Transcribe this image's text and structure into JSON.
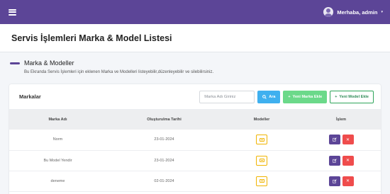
{
  "topbar": {
    "user_label": "Merhaba, admin",
    "caret": "▾",
    "menu_icon": "hamburger-menu-icon",
    "avatar_icon": "user-avatar-icon"
  },
  "page": {
    "title": "Servis İşlemleri Marka & Model Listesi"
  },
  "section": {
    "title": "Marka & Modeller",
    "description": "Bu Ekranda Servis İşlemleri için eklenen Marka ve Modelleri listeyebilir,düzenleyebilir ve silebilirsiniz."
  },
  "card": {
    "title": "Markalar",
    "search_placeholder": "Marka Adı Giriniz",
    "search_button": "Ara",
    "add_brand_button": "Yeni Marka Ekle",
    "add_model_button": "Yeni Model Ekle"
  },
  "table": {
    "headers": [
      "Marka Adı",
      "Oluşturulma Tarihi",
      "Modeller",
      "İşlem"
    ],
    "rows": [
      {
        "name": "Norm",
        "date": "23-01-2024"
      },
      {
        "name": "Bu Model Yendir",
        "date": "23-01-2024"
      },
      {
        "name": "deneme",
        "date": "02-01-2024"
      }
    ]
  },
  "colors": {
    "primary": "#5c4597",
    "info": "#3fb0ef",
    "success": "#6bd98a",
    "warning": "#f0b400",
    "danger": "#ef4c4c"
  }
}
